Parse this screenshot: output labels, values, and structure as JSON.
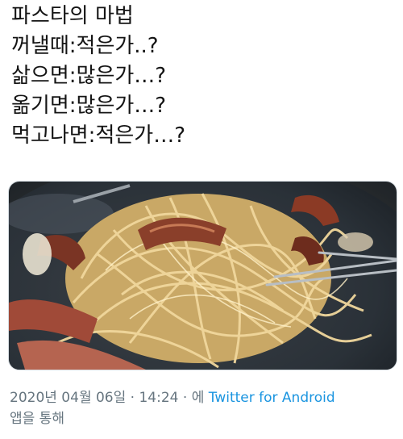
{
  "tweet": {
    "lines": [
      "파스타의 마법",
      "꺼낼때:적은가..?",
      "삶으면:많은가…?",
      "옮기면:많은가…?",
      "먹고나면:적은가…?"
    ]
  },
  "media": {
    "icon": "photo-pasta",
    "colors": {
      "plate": "#2a3138",
      "noodle": "#e2c68a",
      "bacon": "#8a3f2a"
    }
  },
  "meta": {
    "date": "2020년 04월 06일",
    "separator": " · ",
    "time": "14:24",
    "via_prefix": " · 에 ",
    "app": "Twitter for Android",
    "suffix": "앱을 통해"
  }
}
